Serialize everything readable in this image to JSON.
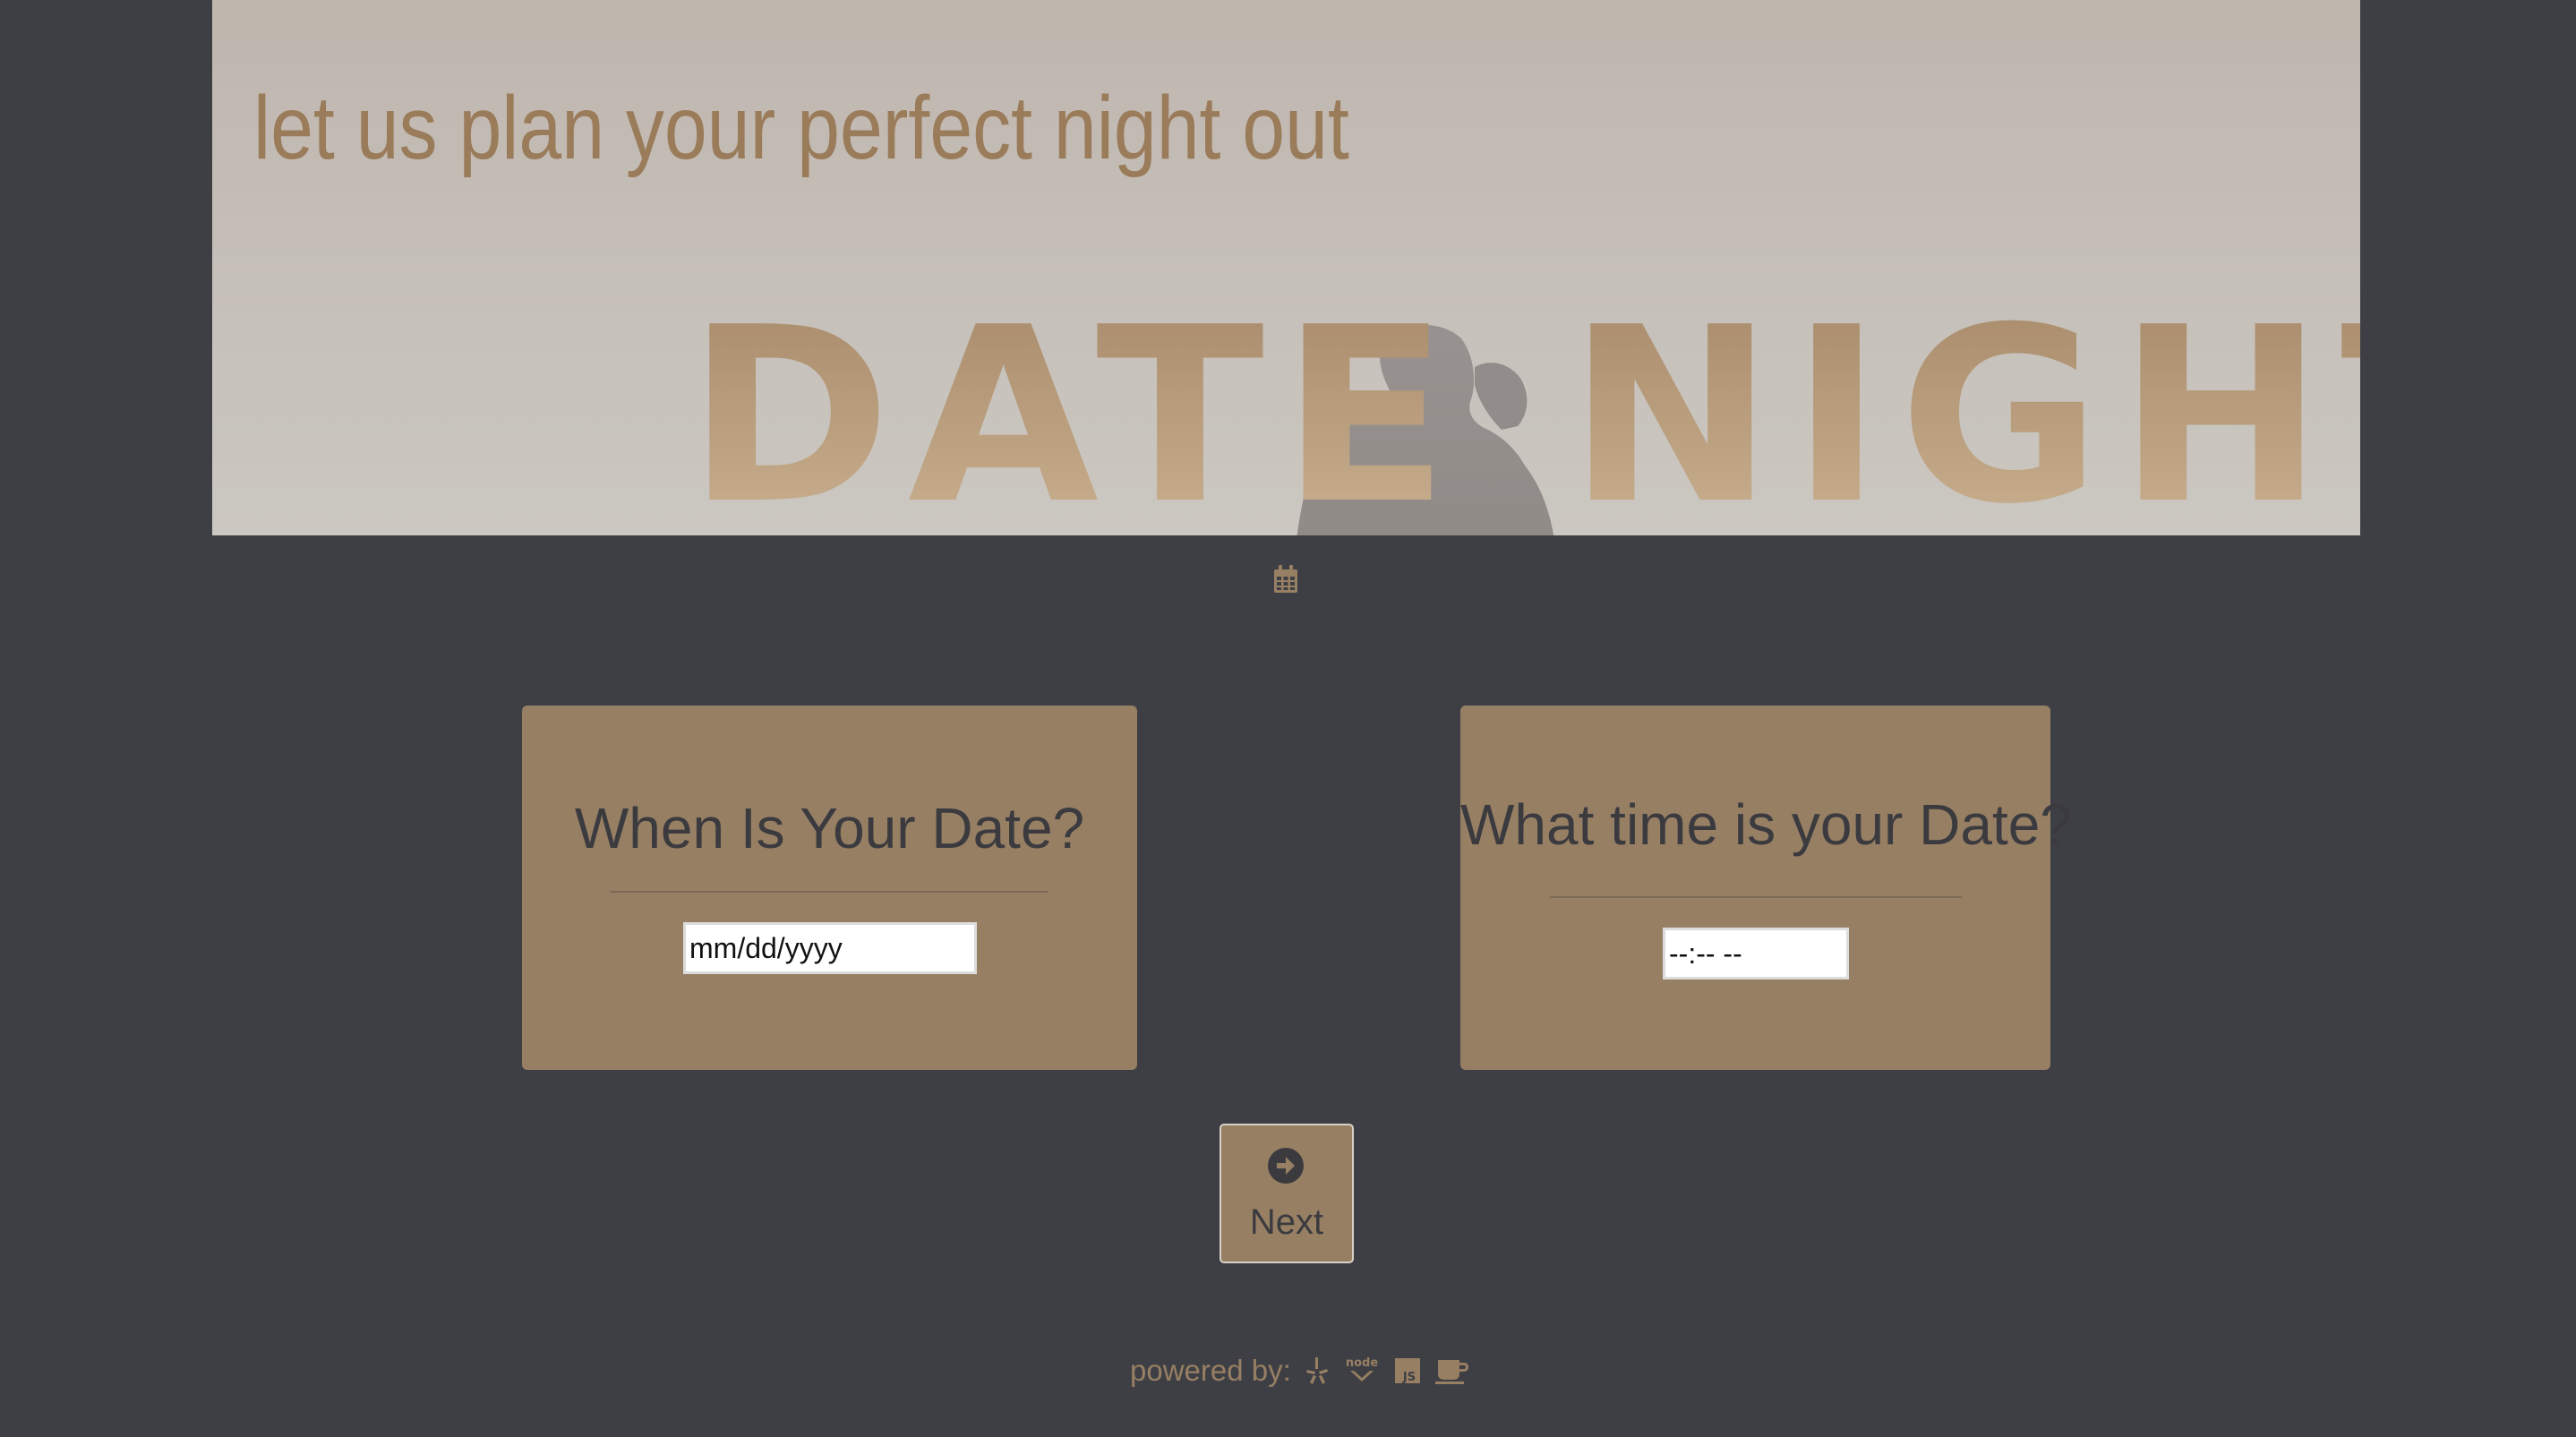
{
  "hero": {
    "tagline": "let us plan your perfect night out",
    "logo_text": "DATE NIGHT",
    "icon": "calendar-icon"
  },
  "date_card": {
    "title": "When Is Your Date?",
    "input_placeholder": "mm/dd/yyyy"
  },
  "time_card": {
    "title": "What time is your Date?",
    "input_placeholder": "--:-- --"
  },
  "next_button": {
    "label": "Next",
    "icon": "arrow-circle-right-icon"
  },
  "footer": {
    "label": "powered by:",
    "icons": [
      "yelp-icon",
      "nodejs-icon",
      "javascript-icon",
      "coffee-icon"
    ]
  },
  "colors": {
    "background": "#3e3f44",
    "accent": "#977f64",
    "text_dark": "#3b3b3f"
  }
}
